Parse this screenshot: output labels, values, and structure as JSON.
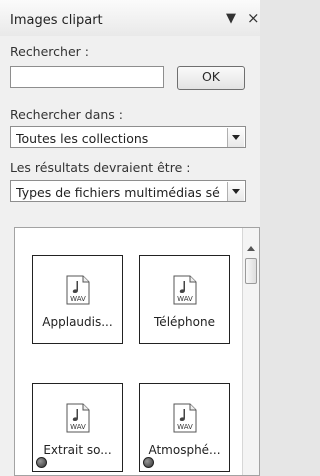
{
  "panel": {
    "title": "Images clipart",
    "menu_glyph": "▼",
    "close_glyph": "×"
  },
  "search": {
    "label": "Rechercher :",
    "value": "",
    "ok_label": "OK"
  },
  "search_in": {
    "label": "Rechercher dans :",
    "selected": "Toutes les collections"
  },
  "result_type": {
    "label": "Les résultats devraient être :",
    "selected": "Types de fichiers multimédias sé"
  },
  "results": {
    "items": [
      {
        "caption": "Applaudis...",
        "icon": "wav-sound-icon",
        "web_badge": false
      },
      {
        "caption": "Téléphone",
        "icon": "wav-sound-icon",
        "web_badge": false
      },
      {
        "caption": "Extrait so...",
        "icon": "wav-sound-icon",
        "web_badge": true
      },
      {
        "caption": "Atmosphé...",
        "icon": "wav-sound-icon",
        "web_badge": true
      }
    ],
    "icon_text": "WAV"
  }
}
